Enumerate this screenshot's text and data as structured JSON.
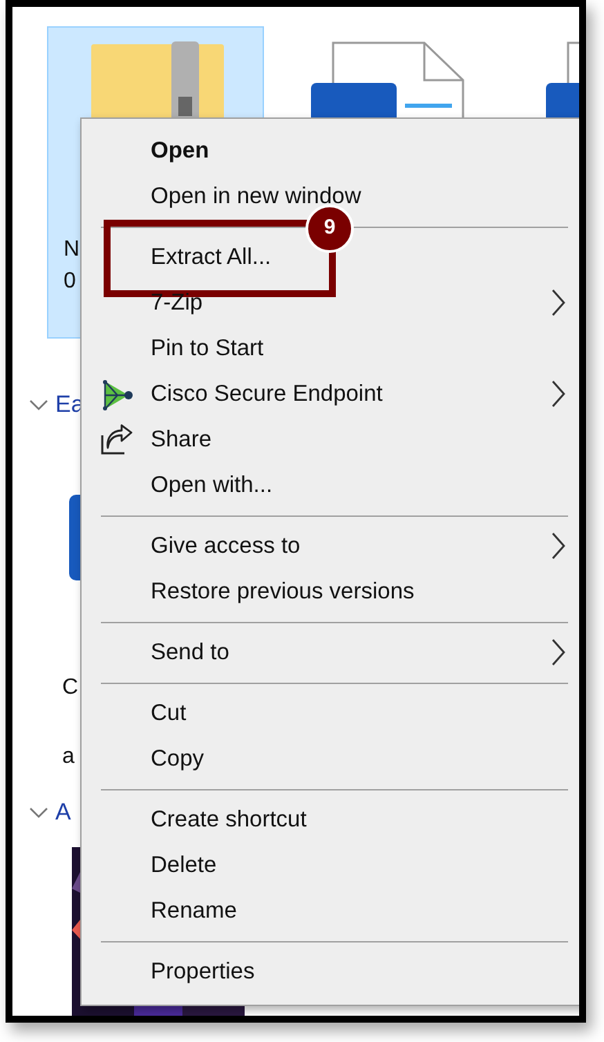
{
  "file_view": {
    "tiles": [
      {
        "kind": "zip",
        "selected": true,
        "name_lines": [
          "N",
          "0"
        ]
      },
      {
        "kind": "word",
        "selected": false
      },
      {
        "kind": "word",
        "selected": false
      }
    ],
    "groups": [
      {
        "heading": "Ea",
        "expanded": true,
        "labels": [
          "C",
          "a"
        ]
      },
      {
        "heading": "A",
        "expanded": true
      }
    ]
  },
  "context_menu": {
    "items": [
      {
        "kind": "text",
        "label": "Open",
        "default": true,
        "submenu": false
      },
      {
        "kind": "text",
        "label": "Open in new window",
        "default": false,
        "submenu": false
      },
      {
        "kind": "separator"
      },
      {
        "kind": "text",
        "label": "Extract All...",
        "default": false,
        "submenu": false,
        "callout_number": "9"
      },
      {
        "kind": "text",
        "label": "7-Zip",
        "default": false,
        "submenu": true
      },
      {
        "kind": "text",
        "label": "Pin to Start",
        "default": false,
        "submenu": false
      },
      {
        "kind": "endpoint",
        "label": "Cisco Secure Endpoint",
        "default": false,
        "submenu": true
      },
      {
        "kind": "share",
        "label": "Share",
        "default": false,
        "submenu": false
      },
      {
        "kind": "text",
        "label": "Open with...",
        "default": false,
        "submenu": false
      },
      {
        "kind": "separator"
      },
      {
        "kind": "text",
        "label": "Give access to",
        "default": false,
        "submenu": true
      },
      {
        "kind": "text",
        "label": "Restore previous versions",
        "default": false,
        "submenu": false
      },
      {
        "kind": "separator"
      },
      {
        "kind": "text",
        "label": "Send to",
        "default": false,
        "submenu": true
      },
      {
        "kind": "separator"
      },
      {
        "kind": "text",
        "label": "Cut",
        "default": false,
        "submenu": false
      },
      {
        "kind": "text",
        "label": "Copy",
        "default": false,
        "submenu": false
      },
      {
        "kind": "separator"
      },
      {
        "kind": "text",
        "label": "Create shortcut",
        "default": false,
        "submenu": false
      },
      {
        "kind": "text",
        "label": "Delete",
        "default": false,
        "submenu": false
      },
      {
        "kind": "text",
        "label": "Rename",
        "default": false,
        "submenu": false
      },
      {
        "kind": "separator"
      },
      {
        "kind": "text",
        "label": "Properties",
        "default": false,
        "submenu": false
      }
    ]
  }
}
